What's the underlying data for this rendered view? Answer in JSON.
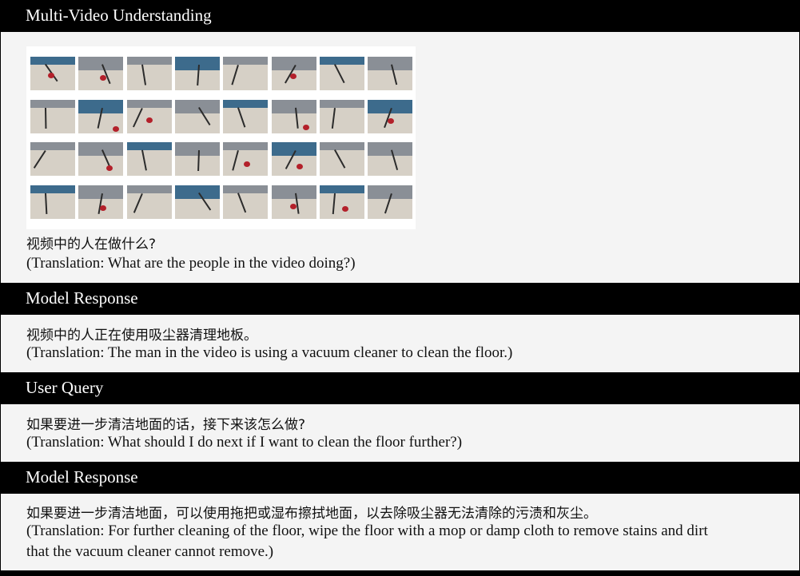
{
  "sections": [
    {
      "header": "Multi-Video Understanding",
      "lines": [
        "视频中的人在做什么?",
        "(Translation: What are the people in the video doing?)"
      ]
    },
    {
      "header": "Model Response",
      "lines": [
        "视频中的人正在使用吸尘器清理地板。",
        "(Translation: The man in the video is using a vacuum cleaner to clean the floor.)"
      ]
    },
    {
      "header": "User Query",
      "lines": [
        "如果要进一步清洁地面的话，接下来该怎么做?",
        "(Translation: What should I do next if I want to clean the floor further?)"
      ]
    },
    {
      "header": "Model Response",
      "lines": [
        "如果要进一步清洁地面，可以使用拖把或湿布擦拭地面，以去除吸尘器无法清除的污渍和灰尘。",
        "(Translation: For further cleaning of the floor, wipe the floor with a mop or damp cloth to remove stains and dirt",
        "that the vacuum cleaner cannot remove.)"
      ]
    }
  ],
  "video_frames": {
    "rows": 4,
    "cols": 8,
    "palette": {
      "floor": "#d6d0c6",
      "wall": "#8a8f96",
      "clutter": "#3d6b8c",
      "vacuum": "#b3202a"
    }
  }
}
